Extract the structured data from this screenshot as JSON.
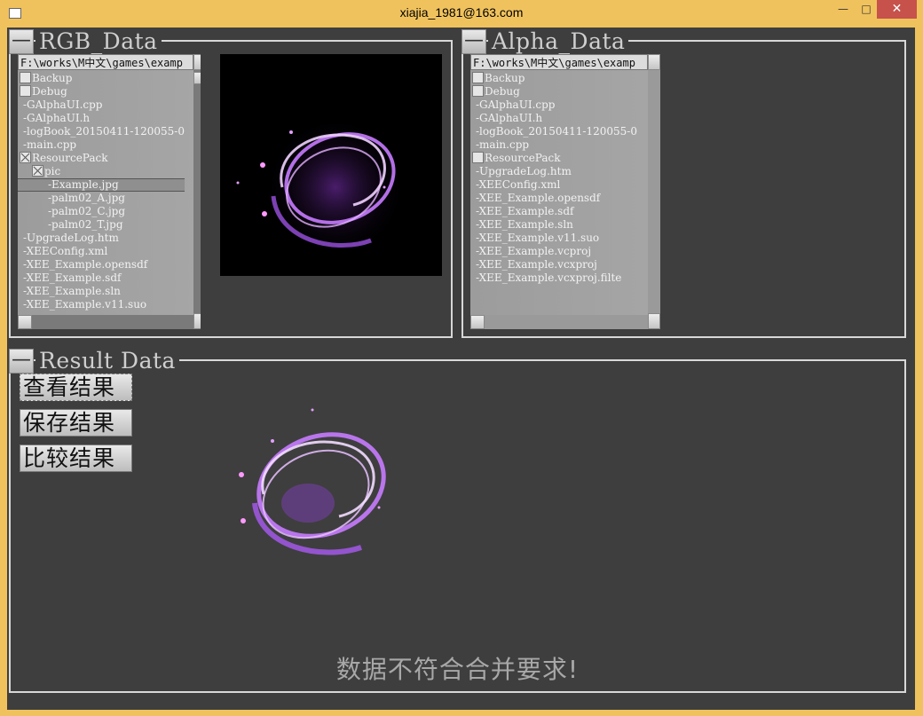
{
  "window": {
    "title": "xiajia_1981@163.com",
    "min_glyph": "—",
    "max_glyph": "□",
    "close_glyph": "✕"
  },
  "rgb": {
    "title": "RGB_Data",
    "collapse": "—",
    "path": "F:\\works\\M中文\\games\\examp",
    "rows": [
      {
        "text": "Backup",
        "box": "plain",
        "indent": 0
      },
      {
        "text": "Debug",
        "box": "plain",
        "indent": 0
      },
      {
        "text": "-GAlphaUI.cpp",
        "box": "none",
        "indent": 0
      },
      {
        "text": "-GAlphaUI.h",
        "box": "none",
        "indent": 0
      },
      {
        "text": "-logBook_20150411-120055-0",
        "box": "none",
        "indent": 0
      },
      {
        "text": "-main.cpp",
        "box": "none",
        "indent": 0
      },
      {
        "text": "ResourcePack",
        "box": "x",
        "indent": 0
      },
      {
        "text": "pic",
        "box": "x",
        "indent": 1
      },
      {
        "text": "-Example.jpg",
        "box": "none",
        "indent": 2,
        "selected": true
      },
      {
        "text": "-palm02_A.jpg",
        "box": "none",
        "indent": 2
      },
      {
        "text": "-palm02_C.jpg",
        "box": "none",
        "indent": 2
      },
      {
        "text": "-palm02_T.jpg",
        "box": "none",
        "indent": 2
      },
      {
        "text": "-UpgradeLog.htm",
        "box": "none",
        "indent": 0
      },
      {
        "text": "-XEEConfig.xml",
        "box": "none",
        "indent": 0
      },
      {
        "text": "-XEE_Example.opensdf",
        "box": "none",
        "indent": 0
      },
      {
        "text": "-XEE_Example.sdf",
        "box": "none",
        "indent": 0
      },
      {
        "text": "-XEE_Example.sln",
        "box": "none",
        "indent": 0
      },
      {
        "text": "-XEE_Example.v11.suo",
        "box": "none",
        "indent": 0
      }
    ]
  },
  "alpha": {
    "title": "Alpha_Data",
    "collapse": "—",
    "path": "F:\\works\\M中文\\games\\examp",
    "rows": [
      {
        "text": "Backup",
        "box": "plain",
        "indent": 0
      },
      {
        "text": "Debug",
        "box": "plain",
        "indent": 0
      },
      {
        "text": "-GAlphaUI.cpp",
        "box": "none",
        "indent": 0
      },
      {
        "text": "-GAlphaUI.h",
        "box": "none",
        "indent": 0
      },
      {
        "text": "-logBook_20150411-120055-0",
        "box": "none",
        "indent": 0
      },
      {
        "text": "-main.cpp",
        "box": "none",
        "indent": 0
      },
      {
        "text": "ResourcePack",
        "box": "plain",
        "indent": 0
      },
      {
        "text": "-UpgradeLog.htm",
        "box": "none",
        "indent": 0
      },
      {
        "text": "-XEEConfig.xml",
        "box": "none",
        "indent": 0
      },
      {
        "text": "-XEE_Example.opensdf",
        "box": "none",
        "indent": 0
      },
      {
        "text": "-XEE_Example.sdf",
        "box": "none",
        "indent": 0
      },
      {
        "text": "-XEE_Example.sln",
        "box": "none",
        "indent": 0
      },
      {
        "text": "-XEE_Example.v11.suo",
        "box": "none",
        "indent": 0
      },
      {
        "text": "-XEE_Example.vcproj",
        "box": "none",
        "indent": 0
      },
      {
        "text": "-XEE_Example.vcxproj",
        "box": "none",
        "indent": 0
      },
      {
        "text": "-XEE_Example.vcxproj.filte",
        "box": "none",
        "indent": 0
      }
    ]
  },
  "result": {
    "title": "Result Data",
    "collapse": "—",
    "buttons": {
      "view": "查看结果",
      "save": "保存结果",
      "compare": "比较结果"
    },
    "status": "数据不符合合并要求!"
  },
  "colors": {
    "accent_purple": "#b84dff",
    "background": "#3e3e3e",
    "frame": "#f0c25d"
  }
}
